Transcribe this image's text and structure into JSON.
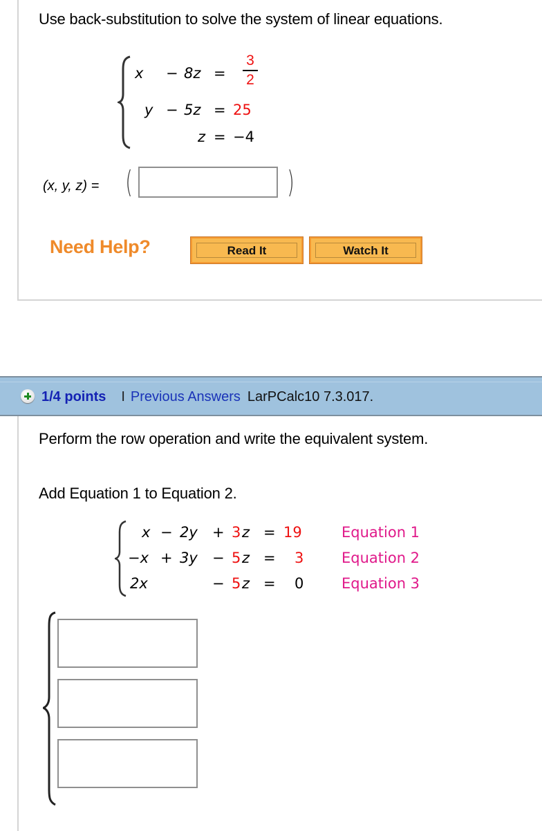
{
  "question1": {
    "prompt": "Use back-substitution to solve the system of linear equations.",
    "system": {
      "rows": [
        {
          "x": "x",
          "y": "",
          "minus": "−",
          "z_term": "8z",
          "eq": "=",
          "rhs_num": "3",
          "rhs_den": "2"
        },
        {
          "x": "",
          "y": "y",
          "minus": "−",
          "z_term": "5z",
          "eq": "=",
          "rhs": "25"
        },
        {
          "x": "",
          "y": "",
          "minus": "",
          "z_term": "z",
          "eq": "=",
          "rhs": "−4"
        }
      ]
    },
    "answer_label": "(x, y, z) =",
    "answer_value": "",
    "help": {
      "label": "Need Help?",
      "read_button": "Read It",
      "watch_button": "Watch It"
    }
  },
  "question2": {
    "header": {
      "icon": "plus-circle-icon",
      "points": "1/4 points",
      "separator": "I",
      "previous_answers": "Previous Answers",
      "reference": "LarPCalc10 7.3.017."
    },
    "prompt": "Perform the row operation and write the equivalent system.",
    "instruction": "Add Equation 1 to Equation 2.",
    "system": {
      "rows": [
        {
          "t1": "x",
          "op1": "−",
          "t2": "2y",
          "op2": "+",
          "zc": "3",
          "zv": "z",
          "eq": "=",
          "rhs": "19",
          "rhs_red": true,
          "label": "Equation 1"
        },
        {
          "t1": "−x",
          "op1": "+",
          "t2": "3y",
          "op2": "−",
          "zc": "5",
          "zv": "z",
          "eq": "=",
          "rhs": "3",
          "rhs_red": true,
          "label": "Equation 2"
        },
        {
          "t1": "2x",
          "op1": "",
          "t2": "",
          "op2": "−",
          "zc": "5",
          "zv": "z",
          "eq": "=",
          "rhs": "0",
          "rhs_red": false,
          "label": "Equation 3"
        }
      ]
    },
    "answer_boxes": [
      "",
      "",
      ""
    ]
  },
  "colors": {
    "accent_red": "#ee1111",
    "equation_label": "#e0198a",
    "need_help": "#ef8a2a",
    "header_bar": "#9fc2de",
    "points_link": "#1422b4"
  }
}
